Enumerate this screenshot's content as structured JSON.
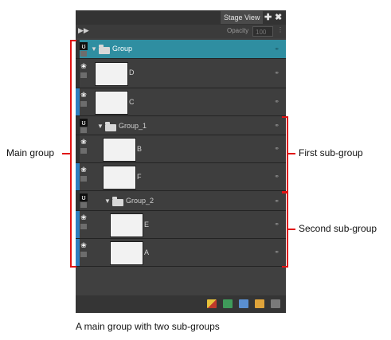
{
  "panel": {
    "tab_title": "Stage View",
    "add_icon": "plus-icon",
    "close_icon": "close-icon",
    "collapse_icon": "double-arrow-right-icon",
    "opacity_label": "Opacity",
    "opacity_value": "100"
  },
  "layers": [
    {
      "kind": "group",
      "label": "Group",
      "selected": true
    },
    {
      "kind": "drawing",
      "label": "D"
    },
    {
      "kind": "drawing",
      "label": "C"
    },
    {
      "kind": "group",
      "label": "Group_1"
    },
    {
      "kind": "drawing",
      "label": "B"
    },
    {
      "kind": "drawing",
      "label": "F"
    },
    {
      "kind": "group",
      "label": "Group_2"
    },
    {
      "kind": "drawing",
      "label": "E"
    },
    {
      "kind": "drawing",
      "label": "A"
    }
  ],
  "footer_icons": [
    "add-layer-icon",
    "add-drawing-layer-icon",
    "add-peg-icon",
    "add-group-icon",
    "delete-icon"
  ],
  "annotations": {
    "main_group": "Main group",
    "first_subgroup": "First sub-group",
    "second_subgroup": "Second sub-group"
  },
  "caption": "A main group with two sub-groups",
  "colors": {
    "selection": "#2f8ea1",
    "annotation": "#e01414",
    "panel": "#404040"
  }
}
